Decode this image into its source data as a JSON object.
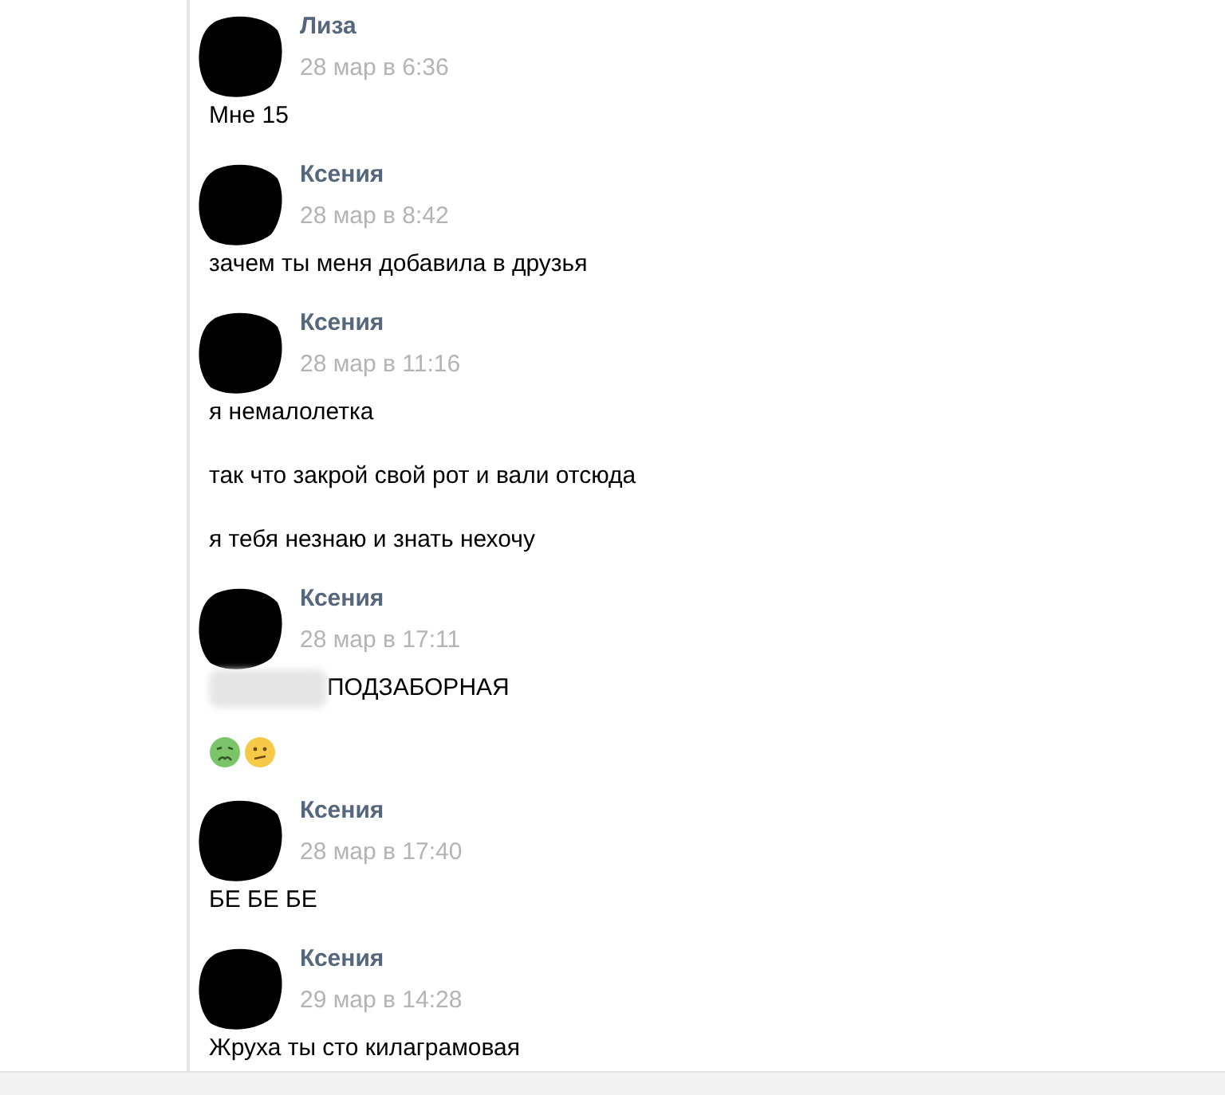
{
  "messages": [
    {
      "author": "Лиза",
      "time": "28 мар в 6:36",
      "items": [
        {
          "kind": "text",
          "text": "Мне 15"
        }
      ]
    },
    {
      "author": "Ксения",
      "time": "28 мар в 8:42",
      "items": [
        {
          "kind": "text",
          "text": "зачем ты меня добавила в друзья"
        }
      ]
    },
    {
      "author": "Ксения",
      "time": "28 мар в 11:16",
      "items": [
        {
          "kind": "text",
          "text": "я немалолетка"
        },
        {
          "kind": "text",
          "text": "так что закрой свой рот и вали отсюда"
        },
        {
          "kind": "text",
          "text": "я тебя незнаю и знать нехочу"
        }
      ]
    },
    {
      "author": "Ксения",
      "time": "28 мар в 17:11",
      "items": [
        {
          "kind": "redacted_text",
          "text": "ПОДЗАБОРНАЯ"
        },
        {
          "kind": "emoji"
        }
      ]
    },
    {
      "author": "Ксения",
      "time": "28 мар в 17:40",
      "items": [
        {
          "kind": "text",
          "text": "БЕ БЕ БЕ"
        }
      ]
    },
    {
      "author": "Ксения",
      "time": "29 мар в 14:28",
      "items": [
        {
          "kind": "text",
          "text": "Жруха ты сто килаграмовая"
        }
      ]
    }
  ]
}
